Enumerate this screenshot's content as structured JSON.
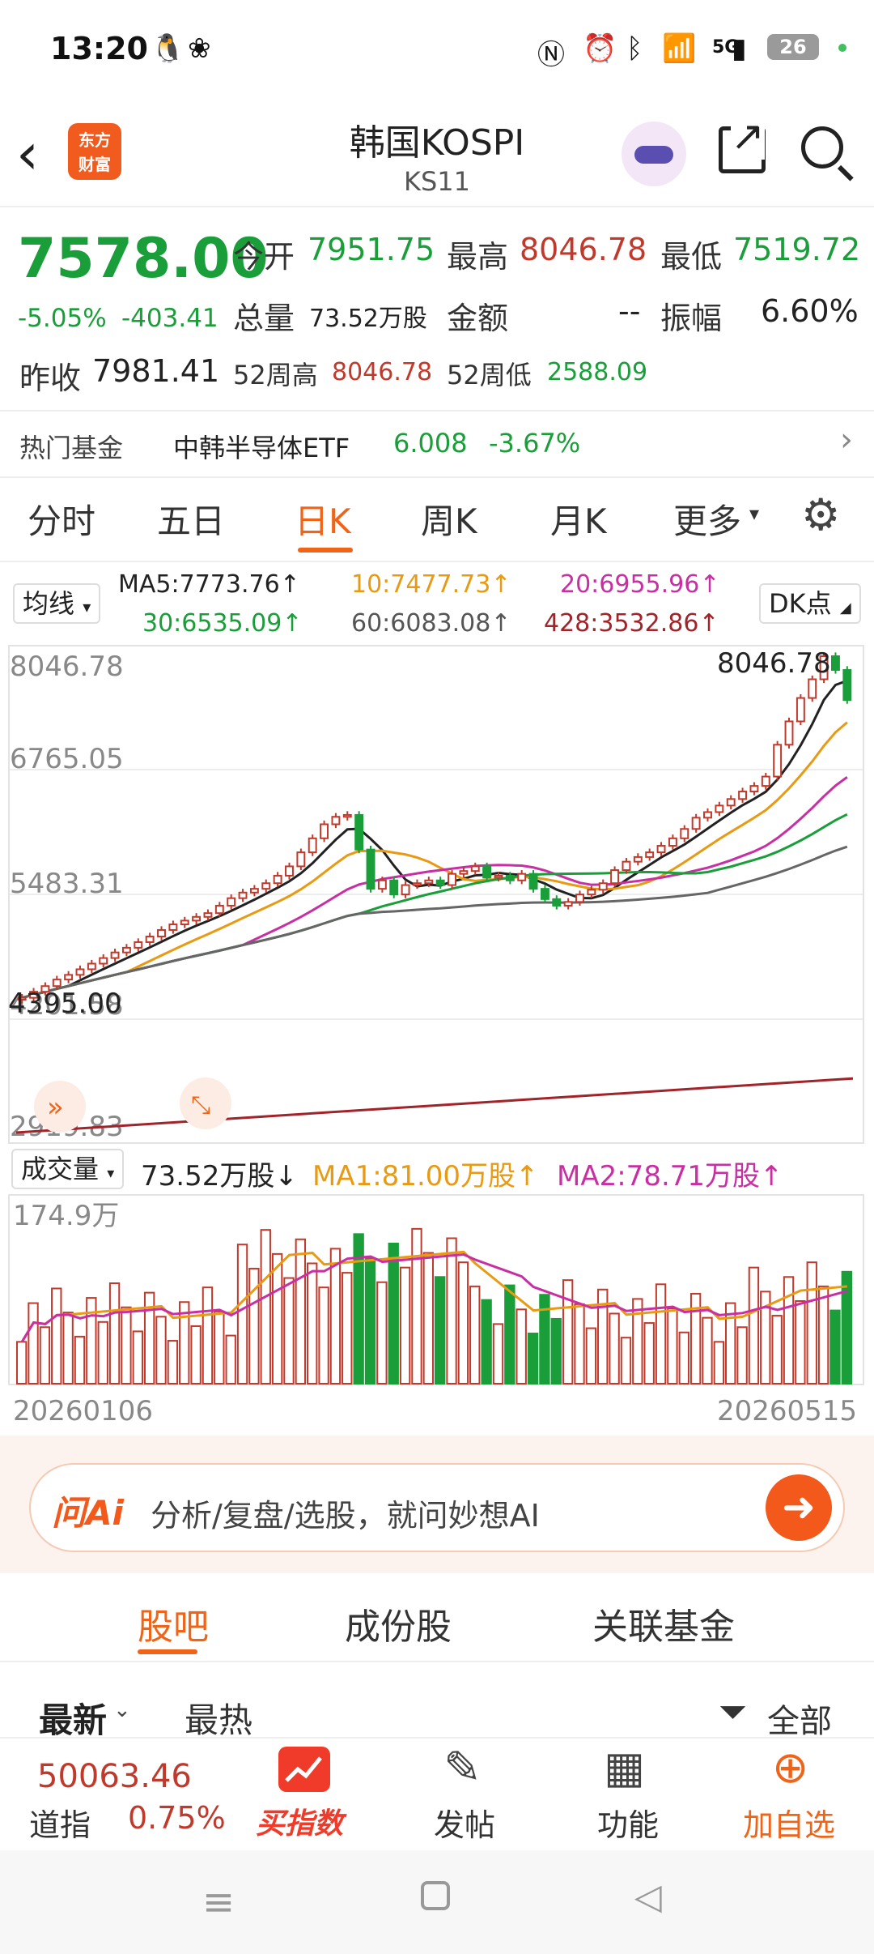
{
  "status_bar": {
    "time": "13:20",
    "battery": "26",
    "network": "5G"
  },
  "header": {
    "back_icon": "chevron-left-icon",
    "logo_line1": "东方",
    "logo_line2": "财富",
    "title": "韩国KOSPI",
    "code": "KS11"
  },
  "quote": {
    "price": "7578.00",
    "change_pct": "-5.05%",
    "change_amt": "-403.41",
    "open_label": "今开",
    "open": "7951.75",
    "high_label": "最高",
    "high": "8046.78",
    "low_label": "最低",
    "low": "7519.72",
    "volume_label": "总量",
    "volume": "73.52万股",
    "amount_label": "金额",
    "amount": "--",
    "amplitude_label": "振幅",
    "amplitude": "6.60%",
    "prev_close_label": "昨收",
    "prev_close": "7981.41",
    "week52_high_label": "52周高",
    "week52_high": "8046.78",
    "week52_low_label": "52周低",
    "week52_low": "2588.09"
  },
  "hot_fund": {
    "label": "热门基金",
    "name": "中韩半导体ETF",
    "price": "6.008",
    "change": "-3.67%",
    "arrow": "›"
  },
  "period_tabs": [
    {
      "label": "分时",
      "active": false
    },
    {
      "label": "五日",
      "active": false
    },
    {
      "label": "日K",
      "active": true
    },
    {
      "label": "周K",
      "active": false
    },
    {
      "label": "月K",
      "active": false
    },
    {
      "label": "更多",
      "active": false
    }
  ],
  "indicator": {
    "selector": "均线",
    "ma5": "MA5:7773.76↑",
    "ma10": "10:7477.73↑",
    "ma20": "20:6955.96↑",
    "ma30": "30:6535.09↑",
    "ma60": "60:6083.08↑",
    "ma428": "428:3532.86↑",
    "dk_button": "DK点"
  },
  "chart_data": {
    "type": "candlestick",
    "y_axis_labels": [
      "8046.78",
      "6765.05",
      "5483.31",
      "4201.58",
      "2919.83"
    ],
    "max_label": "8046.78",
    "min_label": "4395.00",
    "ylim": [
      2919.83,
      8046.78
    ],
    "x_start": "20260106",
    "x_end": "20260515",
    "series": [
      {
        "name": "K线",
        "values": [
          4395,
          4460,
          4520,
          4590,
          4640,
          4700,
          4760,
          4820,
          4880,
          4930,
          4990,
          5050,
          5120,
          5180,
          5220,
          5260,
          5300,
          5380,
          5460,
          5520,
          5560,
          5620,
          5700,
          5800,
          5950,
          6100,
          6250,
          6330,
          6350,
          5980,
          5560,
          5650,
          5500,
          5600,
          5620,
          5650,
          5600,
          5720,
          5750,
          5800,
          5680,
          5700,
          5650,
          5720,
          5560,
          5450,
          5380,
          5420,
          5500,
          5550,
          5620,
          5760,
          5850,
          5900,
          5950,
          6020,
          6100,
          6200,
          6320,
          6380,
          6450,
          6520,
          6600,
          6660,
          6760,
          7100,
          7350,
          7600,
          7800,
          8046.78,
          7900,
          7578
        ]
      }
    ]
  },
  "volume": {
    "selector": "成交量",
    "current": "73.52万股↓",
    "ma1": "MA1:81.00万股↑",
    "ma2": "MA2:78.71万股↑",
    "axis_max": "174.9万"
  },
  "ai_bar": {
    "logo": "问Ai",
    "placeholder": "分析/复盘/选股，就问妙想AI",
    "button_icon": "arrow-right-icon"
  },
  "bottom_tabs": [
    {
      "label": "股吧",
      "active": true
    },
    {
      "label": "成份股",
      "active": false
    },
    {
      "label": "关联基金",
      "active": false
    }
  ],
  "feed_filter": {
    "newest": "最新",
    "hottest": "最热",
    "all": "全部"
  },
  "bottom_nav": {
    "dow_price": "50063.46",
    "dow_label": "道指",
    "dow_change": "0.75%",
    "buy_index": "买指数",
    "post": "发帖",
    "functions": "功能",
    "add_watch": "加自选"
  },
  "colors": {
    "up": "#c0392b",
    "down": "#1a9e3a",
    "accent": "#f06418"
  }
}
